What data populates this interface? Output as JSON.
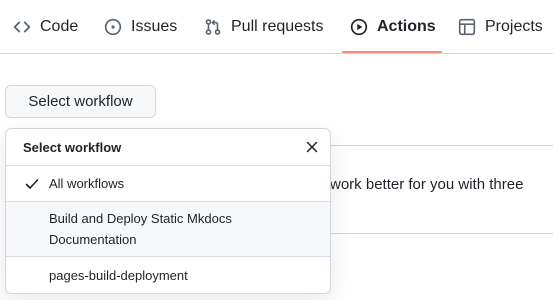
{
  "nav": {
    "tabs": [
      {
        "label": "Code",
        "icon": "code-icon"
      },
      {
        "label": "Issues",
        "icon": "issue-circle-icon"
      },
      {
        "label": "Pull requests",
        "icon": "pull-request-icon"
      },
      {
        "label": "Actions",
        "icon": "play-circle-icon",
        "active": true
      },
      {
        "label": "Projects",
        "icon": "table-icon"
      }
    ],
    "active_underline_color": "#fd8c73"
  },
  "select_workflow_button": {
    "label": "Select workflow"
  },
  "background": {
    "partial_text": "ns work better for you with three"
  },
  "dropdown": {
    "title": "Select workflow",
    "items": [
      {
        "label": "All workflows",
        "selected": true
      },
      {
        "label_line1": "Build and Deploy Static Mkdocs",
        "label_line2": "Documentation"
      },
      {
        "label": "pages-build-deployment"
      }
    ]
  }
}
